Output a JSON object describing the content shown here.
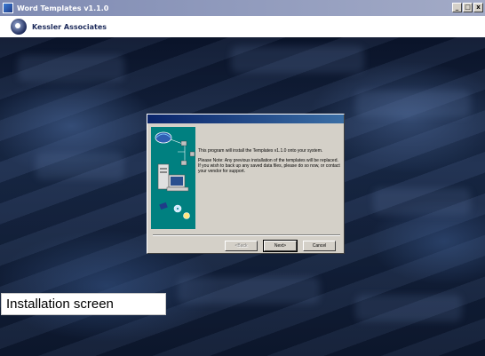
{
  "window": {
    "title": "Word Templates v1.1.0",
    "minimize_label": "_",
    "maximize_label": "□",
    "close_label": "x"
  },
  "header": {
    "company_name": "Kessler Associates"
  },
  "dialog": {
    "intro_text": "This program will install the Templates v1.1.0 onto your system.",
    "note_text": "Please Note: Any previous installation of the templates will be replaced. If you wish to back up any saved data files, please do so now, or contact your vendor for support.",
    "back_label": "<Back",
    "next_label": "Next>",
    "cancel_label": "Cancel"
  },
  "caption": {
    "text": "Installation screen"
  },
  "colors": {
    "dialog_face": "#d4d0c8",
    "wizard_art": "#008080",
    "title_gradient_start": "#0a246a",
    "title_gradient_end": "#3a6ea5"
  }
}
